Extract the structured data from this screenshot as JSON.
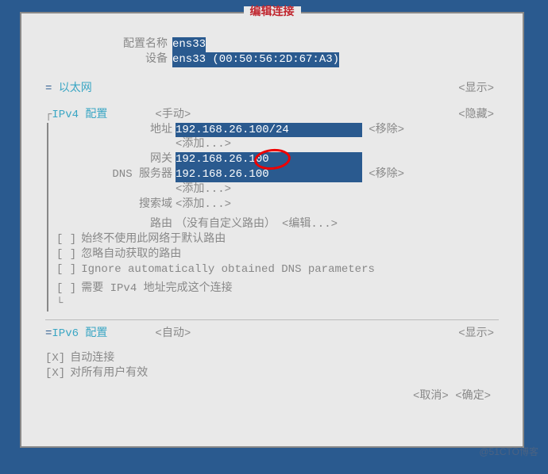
{
  "title": "编辑连接",
  "header": {
    "config_name_label": "配置名称",
    "config_name_value": "ens33",
    "device_label": "设备",
    "device_value": "ens33 (00:50:56:2D:67:A3)"
  },
  "ethernet": {
    "prefix": "=",
    "label": "以太网",
    "show": "<显示>"
  },
  "ipv4": {
    "prefix": "┌",
    "label": "IPv4 配置",
    "mode": "<手动>",
    "hide": "<隐藏>",
    "addr_label": "地址",
    "addr_value": "192.168.26.100/24           ",
    "addr_remove": "<移除>",
    "addr_add": "<添加...>",
    "gw_label": "网关",
    "gw_value": "192.168.26.100              ",
    "dns_label": "DNS 服务器",
    "dns_value": "192.168.26.100              ",
    "dns_remove": "<移除>",
    "dns_add": "<添加...>",
    "search_label": "搜索域",
    "search_add": "<添加...>",
    "route_label": "路由",
    "route_text": "（没有自定义路由）",
    "route_edit": "<编辑...>",
    "chk1": "始终不使用此网络于默认路由",
    "chk2": "忽略自动获取的路由",
    "chk3": "Ignore automatically obtained DNS parameters",
    "chk4": "需要 IPv4 地址完成这个连接"
  },
  "ipv6": {
    "prefix": "=",
    "label": "IPv6 配置",
    "mode": "<自动>",
    "show": "<显示>"
  },
  "auto": {
    "chk_mark": "[X]",
    "auto_connect": "自动连接",
    "all_users": "对所有用户有效"
  },
  "buttons": {
    "cancel": "<取消>",
    "ok": "<确定>"
  },
  "watermark": "@51CTO博客",
  "unchecked": "[ ]"
}
